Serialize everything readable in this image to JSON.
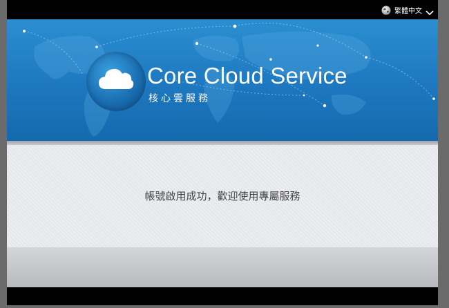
{
  "topbar": {
    "language_label": "繁體中文",
    "globe_icon": "globe-icon",
    "chevron_icon": "chevron-down-icon"
  },
  "banner": {
    "title": "Core Cloud Service",
    "subtitle": "核心雲服務",
    "logo_icon": "cloud-icon"
  },
  "content": {
    "message": "帳號啟用成功，歡迎使用專屬服務"
  },
  "colors": {
    "banner_blue": "#1d78bf",
    "content_bg": "#e6e8ec",
    "text": "#444444"
  }
}
